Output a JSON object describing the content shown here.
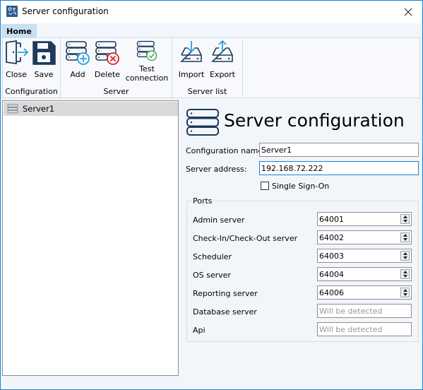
{
  "window": {
    "title": "Server configuration",
    "close_icon": "close-icon"
  },
  "ribbon": {
    "tab": "Home",
    "groups": [
      {
        "label": "Configuration",
        "buttons": [
          {
            "label": "Close",
            "icon": "exit-door-icon"
          },
          {
            "label": "Save",
            "icon": "floppy-disk-icon"
          }
        ]
      },
      {
        "label": "Server",
        "buttons": [
          {
            "label": "Add",
            "icon": "server-add-icon"
          },
          {
            "label": "Delete",
            "icon": "server-delete-icon"
          },
          {
            "label": "Test connection",
            "label_line1": "Test",
            "label_line2": "connection",
            "icon": "server-check-icon"
          }
        ]
      },
      {
        "label": "Server list",
        "buttons": [
          {
            "label": "Import",
            "icon": "drive-import-icon"
          },
          {
            "label": "Export",
            "icon": "drive-export-icon"
          }
        ]
      }
    ]
  },
  "tree": {
    "items": [
      {
        "label": "Server1",
        "icon": "server-icon",
        "selected": true
      }
    ]
  },
  "form": {
    "heading": "Server configuration",
    "configuration_name_label": "Configuration name:",
    "configuration_name_value": "Server1",
    "server_address_label": "Server address:",
    "server_address_value": "192.168.72.222",
    "single_sign_on_label": "Single Sign-On",
    "single_sign_on_checked": false,
    "ports": {
      "legend": "Ports",
      "rows": [
        {
          "label": "Admin server",
          "value": "64001",
          "type": "spin"
        },
        {
          "label": "Check-In/Check-Out server",
          "value": "64002",
          "type": "spin"
        },
        {
          "label": "Scheduler",
          "value": "64003",
          "type": "spin"
        },
        {
          "label": "OS server",
          "value": "64004",
          "type": "spin"
        },
        {
          "label": "Reporting server",
          "value": "64006",
          "type": "spin"
        },
        {
          "label": "Database server",
          "placeholder": "Will be detected",
          "type": "text"
        },
        {
          "label": "Api",
          "placeholder": "Will be detected",
          "type": "text"
        }
      ]
    }
  }
}
